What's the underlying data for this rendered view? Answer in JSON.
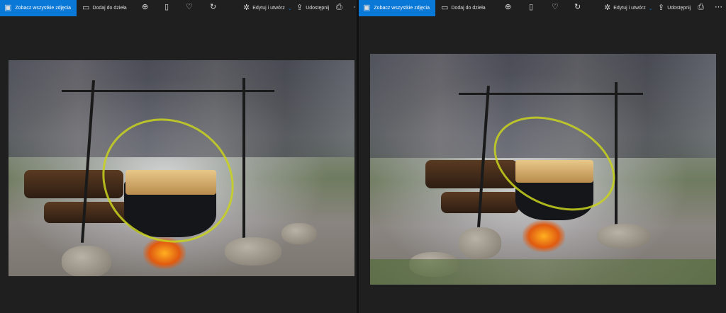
{
  "windows": [
    {
      "toolbar": {
        "see_all": "Zobacz wszystkie zdjęcia",
        "add_to": "Dodaj do dzieła",
        "edit": "Edytuj i utwórz",
        "share": "Udostępnij"
      },
      "icons": [
        "photos-icon",
        "add-creation-icon",
        "zoom-in-icon",
        "delete-icon",
        "favorite-icon",
        "rotate-icon",
        "edit-icon",
        "chevron-down-icon",
        "share-icon",
        "print-icon",
        "more-icon"
      ]
    },
    {
      "toolbar": {
        "see_all": "Zobacz wszystkie zdjęcia",
        "add_to": "Dodaj do dzieła",
        "edit": "Edytuj i utwórz",
        "share": "Udostępnij"
      },
      "icons": [
        "photos-icon",
        "add-creation-icon",
        "zoom-in-icon",
        "delete-icon",
        "favorite-icon",
        "rotate-icon",
        "edit-icon",
        "chevron-down-icon",
        "share-icon",
        "print-icon",
        "more-icon"
      ]
    }
  ],
  "colors": {
    "accent": "#0a78d7",
    "background": "#1f1f1f",
    "highlight": "#c8d21e"
  }
}
